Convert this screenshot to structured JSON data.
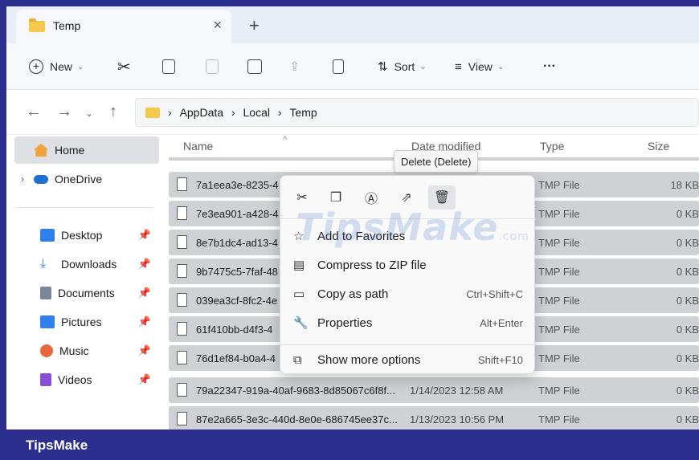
{
  "window": {
    "tab_title": "Temp",
    "tab_close": "×",
    "new_tab": "+"
  },
  "toolbar": {
    "new_label": "New",
    "sort_label": "Sort",
    "view_label": "View",
    "more_label": "···"
  },
  "address": {
    "crumbs": [
      "AppData",
      "Local",
      "Temp"
    ],
    "separator": "›"
  },
  "sidebar": {
    "items": [
      {
        "label": "Home",
        "icon": "home-icon",
        "color": "#f0a23c"
      },
      {
        "label": "OneDrive",
        "icon": "cloud-icon",
        "color": "#1f6fd1"
      },
      {
        "label": "Desktop",
        "icon": "desktop-icon",
        "color": "#2f80ed"
      },
      {
        "label": "Downloads",
        "icon": "download-icon",
        "color": "#2f80ed"
      },
      {
        "label": "Documents",
        "icon": "document-icon",
        "color": "#7b8699"
      },
      {
        "label": "Pictures",
        "icon": "picture-icon",
        "color": "#2f80ed"
      },
      {
        "label": "Music",
        "icon": "music-icon",
        "color": "#e5673a"
      },
      {
        "label": "Videos",
        "icon": "video-icon",
        "color": "#8a4fd1"
      }
    ]
  },
  "columns": {
    "name": "Name",
    "date": "Date modified",
    "type": "Type",
    "size": "Size"
  },
  "files": [
    {
      "name": "7a1eea3e-8235-4",
      "date": "",
      "type": "TMP File",
      "size": "18 KB"
    },
    {
      "name": "7e3ea901-a428-4",
      "date": "",
      "type": "TMP File",
      "size": "0 KB"
    },
    {
      "name": "8e7b1dc4-ad13-4",
      "date": "",
      "type": "TMP File",
      "size": "0 KB"
    },
    {
      "name": "9b7475c5-7faf-48",
      "date": "",
      "type": "TMP File",
      "size": "0 KB"
    },
    {
      "name": "039ea3cf-8fc2-4e",
      "date": "",
      "type": "TMP File",
      "size": "0 KB"
    },
    {
      "name": "61f410bb-d4f3-4",
      "date": "",
      "type": "TMP File",
      "size": "0 KB"
    },
    {
      "name": "76d1ef84-b0a4-4",
      "date": "",
      "type": "TMP File",
      "size": "0 KB"
    },
    {
      "name": "79a22347-919a-40af-9683-8d85067c6f8f...",
      "date": "1/14/2023 12:58 AM",
      "type": "TMP File",
      "size": "0 KB"
    },
    {
      "name": "87e2a665-3e3c-440d-8e0e-686745ee37c...",
      "date": "1/13/2023 10:56 PM",
      "type": "TMP File",
      "size": "0 KB"
    }
  ],
  "context_menu": {
    "items": [
      {
        "label": "Add to Favorites",
        "shortcut": "",
        "icon": "star-icon"
      },
      {
        "label": "Compress to ZIP file",
        "shortcut": "",
        "icon": "zip-icon"
      },
      {
        "label": "Copy as path",
        "shortcut": "Ctrl+Shift+C",
        "icon": "copy-path-icon"
      },
      {
        "label": "Properties",
        "shortcut": "Alt+Enter",
        "icon": "wrench-icon"
      },
      {
        "label": "Show more options",
        "shortcut": "Shift+F10",
        "icon": "more-options-icon"
      }
    ]
  },
  "tooltip": "Delete (Delete)",
  "watermark": {
    "main": "TipsMake",
    "suffix": ".com"
  },
  "footer": "TipsMake"
}
